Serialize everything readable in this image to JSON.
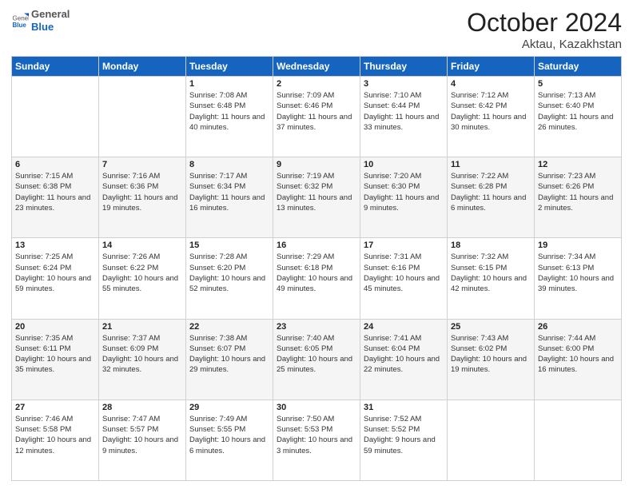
{
  "header": {
    "logo_general": "General",
    "logo_blue": "Blue",
    "month": "October 2024",
    "location": "Aktau, Kazakhstan"
  },
  "weekdays": [
    "Sunday",
    "Monday",
    "Tuesday",
    "Wednesday",
    "Thursday",
    "Friday",
    "Saturday"
  ],
  "weeks": [
    [
      {
        "day": "",
        "sunrise": "",
        "sunset": "",
        "daylight": ""
      },
      {
        "day": "",
        "sunrise": "",
        "sunset": "",
        "daylight": ""
      },
      {
        "day": "1",
        "sunrise": "Sunrise: 7:08 AM",
        "sunset": "Sunset: 6:48 PM",
        "daylight": "Daylight: 11 hours and 40 minutes."
      },
      {
        "day": "2",
        "sunrise": "Sunrise: 7:09 AM",
        "sunset": "Sunset: 6:46 PM",
        "daylight": "Daylight: 11 hours and 37 minutes."
      },
      {
        "day": "3",
        "sunrise": "Sunrise: 7:10 AM",
        "sunset": "Sunset: 6:44 PM",
        "daylight": "Daylight: 11 hours and 33 minutes."
      },
      {
        "day": "4",
        "sunrise": "Sunrise: 7:12 AM",
        "sunset": "Sunset: 6:42 PM",
        "daylight": "Daylight: 11 hours and 30 minutes."
      },
      {
        "day": "5",
        "sunrise": "Sunrise: 7:13 AM",
        "sunset": "Sunset: 6:40 PM",
        "daylight": "Daylight: 11 hours and 26 minutes."
      }
    ],
    [
      {
        "day": "6",
        "sunrise": "Sunrise: 7:15 AM",
        "sunset": "Sunset: 6:38 PM",
        "daylight": "Daylight: 11 hours and 23 minutes."
      },
      {
        "day": "7",
        "sunrise": "Sunrise: 7:16 AM",
        "sunset": "Sunset: 6:36 PM",
        "daylight": "Daylight: 11 hours and 19 minutes."
      },
      {
        "day": "8",
        "sunrise": "Sunrise: 7:17 AM",
        "sunset": "Sunset: 6:34 PM",
        "daylight": "Daylight: 11 hours and 16 minutes."
      },
      {
        "day": "9",
        "sunrise": "Sunrise: 7:19 AM",
        "sunset": "Sunset: 6:32 PM",
        "daylight": "Daylight: 11 hours and 13 minutes."
      },
      {
        "day": "10",
        "sunrise": "Sunrise: 7:20 AM",
        "sunset": "Sunset: 6:30 PM",
        "daylight": "Daylight: 11 hours and 9 minutes."
      },
      {
        "day": "11",
        "sunrise": "Sunrise: 7:22 AM",
        "sunset": "Sunset: 6:28 PM",
        "daylight": "Daylight: 11 hours and 6 minutes."
      },
      {
        "day": "12",
        "sunrise": "Sunrise: 7:23 AM",
        "sunset": "Sunset: 6:26 PM",
        "daylight": "Daylight: 11 hours and 2 minutes."
      }
    ],
    [
      {
        "day": "13",
        "sunrise": "Sunrise: 7:25 AM",
        "sunset": "Sunset: 6:24 PM",
        "daylight": "Daylight: 10 hours and 59 minutes."
      },
      {
        "day": "14",
        "sunrise": "Sunrise: 7:26 AM",
        "sunset": "Sunset: 6:22 PM",
        "daylight": "Daylight: 10 hours and 55 minutes."
      },
      {
        "day": "15",
        "sunrise": "Sunrise: 7:28 AM",
        "sunset": "Sunset: 6:20 PM",
        "daylight": "Daylight: 10 hours and 52 minutes."
      },
      {
        "day": "16",
        "sunrise": "Sunrise: 7:29 AM",
        "sunset": "Sunset: 6:18 PM",
        "daylight": "Daylight: 10 hours and 49 minutes."
      },
      {
        "day": "17",
        "sunrise": "Sunrise: 7:31 AM",
        "sunset": "Sunset: 6:16 PM",
        "daylight": "Daylight: 10 hours and 45 minutes."
      },
      {
        "day": "18",
        "sunrise": "Sunrise: 7:32 AM",
        "sunset": "Sunset: 6:15 PM",
        "daylight": "Daylight: 10 hours and 42 minutes."
      },
      {
        "day": "19",
        "sunrise": "Sunrise: 7:34 AM",
        "sunset": "Sunset: 6:13 PM",
        "daylight": "Daylight: 10 hours and 39 minutes."
      }
    ],
    [
      {
        "day": "20",
        "sunrise": "Sunrise: 7:35 AM",
        "sunset": "Sunset: 6:11 PM",
        "daylight": "Daylight: 10 hours and 35 minutes."
      },
      {
        "day": "21",
        "sunrise": "Sunrise: 7:37 AM",
        "sunset": "Sunset: 6:09 PM",
        "daylight": "Daylight: 10 hours and 32 minutes."
      },
      {
        "day": "22",
        "sunrise": "Sunrise: 7:38 AM",
        "sunset": "Sunset: 6:07 PM",
        "daylight": "Daylight: 10 hours and 29 minutes."
      },
      {
        "day": "23",
        "sunrise": "Sunrise: 7:40 AM",
        "sunset": "Sunset: 6:05 PM",
        "daylight": "Daylight: 10 hours and 25 minutes."
      },
      {
        "day": "24",
        "sunrise": "Sunrise: 7:41 AM",
        "sunset": "Sunset: 6:04 PM",
        "daylight": "Daylight: 10 hours and 22 minutes."
      },
      {
        "day": "25",
        "sunrise": "Sunrise: 7:43 AM",
        "sunset": "Sunset: 6:02 PM",
        "daylight": "Daylight: 10 hours and 19 minutes."
      },
      {
        "day": "26",
        "sunrise": "Sunrise: 7:44 AM",
        "sunset": "Sunset: 6:00 PM",
        "daylight": "Daylight: 10 hours and 16 minutes."
      }
    ],
    [
      {
        "day": "27",
        "sunrise": "Sunrise: 7:46 AM",
        "sunset": "Sunset: 5:58 PM",
        "daylight": "Daylight: 10 hours and 12 minutes."
      },
      {
        "day": "28",
        "sunrise": "Sunrise: 7:47 AM",
        "sunset": "Sunset: 5:57 PM",
        "daylight": "Daylight: 10 hours and 9 minutes."
      },
      {
        "day": "29",
        "sunrise": "Sunrise: 7:49 AM",
        "sunset": "Sunset: 5:55 PM",
        "daylight": "Daylight: 10 hours and 6 minutes."
      },
      {
        "day": "30",
        "sunrise": "Sunrise: 7:50 AM",
        "sunset": "Sunset: 5:53 PM",
        "daylight": "Daylight: 10 hours and 3 minutes."
      },
      {
        "day": "31",
        "sunrise": "Sunrise: 7:52 AM",
        "sunset": "Sunset: 5:52 PM",
        "daylight": "Daylight: 9 hours and 59 minutes."
      },
      {
        "day": "",
        "sunrise": "",
        "sunset": "",
        "daylight": ""
      },
      {
        "day": "",
        "sunrise": "",
        "sunset": "",
        "daylight": ""
      }
    ]
  ]
}
